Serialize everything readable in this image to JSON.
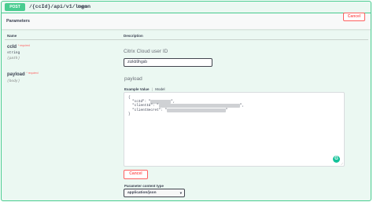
{
  "operation": {
    "method": "POST",
    "path": "/{ccId}/api/v1/logon",
    "summary": "logon"
  },
  "parameters_section": {
    "title": "Parameters",
    "cancel_label": "Cancel"
  },
  "columns": {
    "name": "Name",
    "description": "Description"
  },
  "params": [
    {
      "name": "ccId",
      "required_label": "* required",
      "type": "string",
      "location": "(path)",
      "description": "Citrix Cloud user ID",
      "value": "zizkb9hgsb"
    },
    {
      "name": "payload",
      "required_label": "* required",
      "location": "(body)",
      "description": "payload"
    }
  ],
  "body_editor": {
    "tab_example": "Example Value",
    "tab_model": "Model",
    "line_open": "{",
    "cc_key": "  \"ccId\": \"",
    "cc_end": "\",",
    "client_id_key": "  \"clientId\": \"",
    "client_id_end": "\",",
    "client_secret_key": "  \"clientSecret\": \"",
    "client_secret_end": "\"",
    "line_close": "}",
    "masked_short": "xxxxxxxxxx",
    "masked_long": "xxxxxxxxxxxxxxxxxxxxxxxxxxxxxxxxxxxxxxxx",
    "masked_mid": "xxxxxxxxxxxxxxxxxxxxxxxxxxxxx",
    "grammarly_glyph": "G",
    "resize_glyph": "⟋"
  },
  "bottom": {
    "cancel_label": "Cancel",
    "content_type_label": "Parameter content type",
    "content_type_value": "application/json",
    "select_arrow": "▾"
  },
  "colors": {
    "post_green": "#49cc90",
    "cancel_red": "#ff6060"
  }
}
